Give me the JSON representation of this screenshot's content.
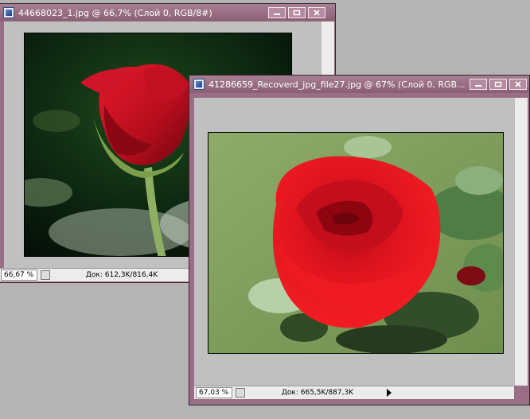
{
  "window_back": {
    "title": "44668023_1.jpg @ 66,7% (Слой 0, RGB/8#)",
    "zoom": "66,67 %",
    "doc_info": "Док: 612,3K/816,4K"
  },
  "window_front": {
    "title": "41286659_Recoverd_jpg_file27.jpg @ 67% (Слой 0, RGB...",
    "zoom": "67,03 %",
    "doc_info": "Док: 665,5K/887,3K"
  },
  "icons": [
    "photoshop-doc-icon",
    "minimize-icon",
    "maximize-icon",
    "close-icon",
    "status-menu-icon",
    "play-arrow-icon"
  ],
  "colors": {
    "title_bar": "#8a5f74",
    "canvas": "#c0c0c0",
    "status_bar": "#ececec"
  }
}
